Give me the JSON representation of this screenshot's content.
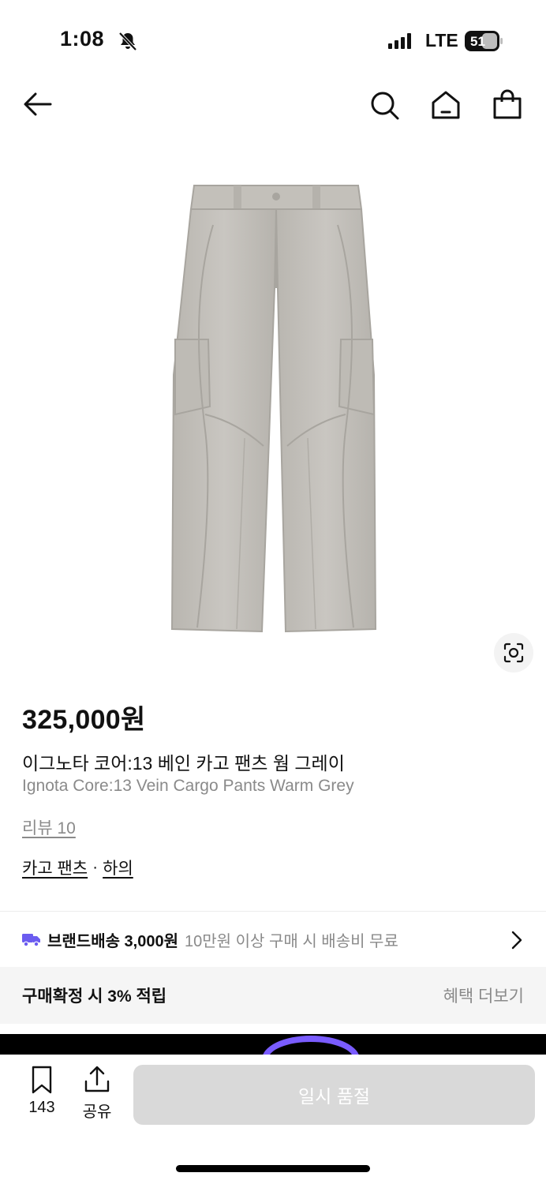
{
  "status_bar": {
    "time": "1:08",
    "network": "LTE",
    "battery": "51"
  },
  "nav": {
    "icons": [
      "back-arrow-icon",
      "search-icon",
      "home-icon",
      "shopping-bag-icon"
    ]
  },
  "product": {
    "price": "325,000원",
    "name_ko": "이그노타 코어:13 베인 카고 팬츠 웜 그레이",
    "name_en": "Ignota Core:13 Vein Cargo Pants Warm Grey",
    "review_label": "리뷰 10",
    "category": "카고 팬츠",
    "category_sep": "·",
    "parent_category": "하의"
  },
  "shipping": {
    "label": "브랜드배송 3,000원",
    "sub": "10만원 이상 구매 시 배송비 무료",
    "icon_color": "#6b5cf0"
  },
  "benefit": {
    "label": "구매확정 시 3% 적립",
    "more": "혜택 더보기"
  },
  "bottom": {
    "bookmark_count": "143",
    "share_label": "공유",
    "soldout_label": "일시 품절"
  }
}
